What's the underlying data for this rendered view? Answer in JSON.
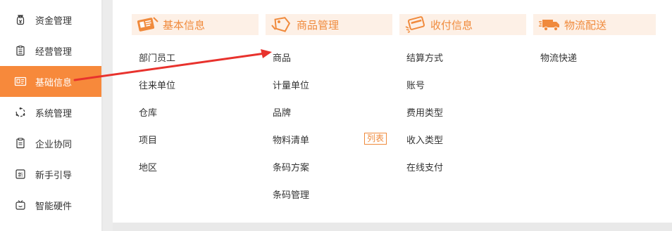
{
  "sidebar": {
    "items": [
      {
        "label": "资金管理",
        "icon": "money-bag-icon",
        "active": false
      },
      {
        "label": "经营管理",
        "icon": "clipboard-icon",
        "active": false
      },
      {
        "label": "基础信息",
        "icon": "id-card-icon",
        "active": true
      },
      {
        "label": "系统管理",
        "icon": "cycle-icon",
        "active": false
      },
      {
        "label": "企业协同",
        "icon": "document-icon",
        "active": false
      },
      {
        "label": "新手引导",
        "icon": "new-badge-icon",
        "active": false
      },
      {
        "label": "智能硬件",
        "icon": "tv-robot-icon",
        "active": false
      }
    ]
  },
  "colors": {
    "accent": "#f7893b",
    "header_bg": "#fdf0e6",
    "header_text": "#f08a3c",
    "arrow": "#e8322d"
  },
  "columns": [
    {
      "title": "基本信息",
      "icon": "profile-card-icon",
      "links": [
        "部门员工",
        "往来单位",
        "仓库",
        "项目",
        "地区"
      ]
    },
    {
      "title": "商品管理",
      "icon": "price-tag-icon",
      "links": [
        "商品",
        "计量单位",
        "品牌",
        "物料清单",
        "条码方案",
        "条码管理"
      ],
      "tag": {
        "after": "物料清单",
        "label": "列表"
      }
    },
    {
      "title": "收付信息",
      "icon": "payment-card-icon",
      "links": [
        "结算方式",
        "账号",
        "费用类型",
        "收入类型",
        "在线支付"
      ]
    },
    {
      "title": "物流配送",
      "icon": "delivery-truck-icon",
      "links": [
        "物流快递"
      ]
    }
  ]
}
